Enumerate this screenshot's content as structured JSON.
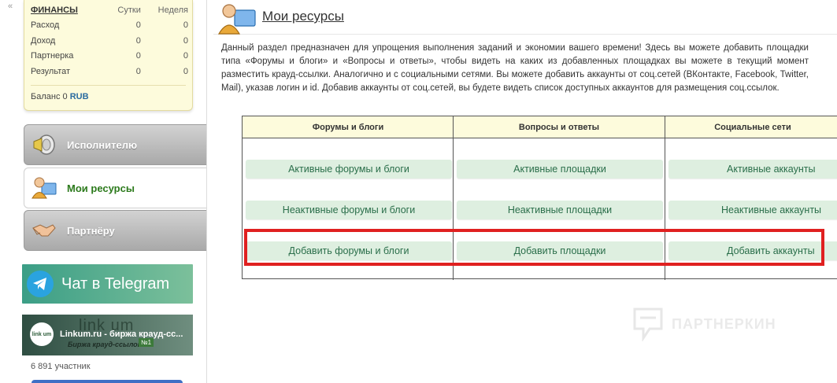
{
  "sidebar": {
    "collapse_glyph": "«",
    "finance": {
      "title": "ФИНАНСЫ",
      "col_day": "Сутки",
      "col_week": "Неделя",
      "rows": [
        {
          "label": "Расход",
          "day": "0",
          "week": "0"
        },
        {
          "label": "Доход",
          "day": "0",
          "week": "0"
        },
        {
          "label": "Партнерка",
          "day": "0",
          "week": "0"
        },
        {
          "label": "Результат",
          "day": "0",
          "week": "0"
        }
      ],
      "balance_label": "Баланс 0",
      "balance_currency": "RUB"
    },
    "nav": {
      "executor": "Исполнителю",
      "resources": "Мои ресурсы",
      "partner": "Партнёру"
    },
    "telegram": {
      "label": "Чат в Telegram"
    },
    "linkum": {
      "logo_text": "link um",
      "bg_text": "link um",
      "title": "Linkum.ru - биржа крауд-сс...",
      "subtitle": "Биржа крауд-ссылок",
      "badge": "№1",
      "participants": "6 891 участник"
    }
  },
  "main": {
    "title": "Мои ресурсы",
    "intro": "Данный раздел предназначен для упрощения выполнения заданий и экономии вашего времени! Здесь вы можете добавить площадки типа «Форумы и блоги» и «Вопросы и ответы», чтобы видеть на каких из добавленных площадках вы можете в текущий момент разместить крауд-ссылки. Аналогично и с социальными сетями. Вы можете добавить аккаунты от соц.сетей (ВКонтакте, Facebook, Twitter, Mail), указав логин и id. Добавив аккаунты от соц.сетей, вы будете видеть список доступных аккаунтов для размещения соц.ссылок.",
    "columns": [
      {
        "header": "Форумы и блоги",
        "active": "Активные форумы и блоги",
        "inactive": "Неактивные форумы и блоги",
        "add": "Добавить форумы и блоги"
      },
      {
        "header": "Вопросы и ответы",
        "active": "Активные площадки",
        "inactive": "Неактивные площадки",
        "add": "Добавить площадки"
      },
      {
        "header": "Социальные сети",
        "active": "Активные аккаунты",
        "inactive": "Неактивные аккаунты",
        "add": "Добавить аккаунты"
      }
    ]
  },
  "watermark": {
    "text": "ПАРТНЕРКИН"
  },
  "colors": {
    "highlight": "#e02020",
    "button_bg": "#deefe0",
    "button_text": "#2a6e4a",
    "finance_bg": "#fdfbdc"
  }
}
